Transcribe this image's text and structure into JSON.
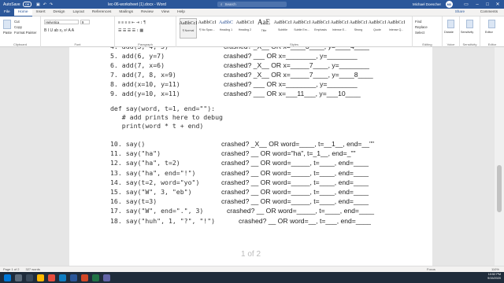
{
  "titlebar": {
    "autosave": "AutoSave",
    "autosave_state": "Off",
    "doc_title": "lec-06-worksheet (1).docx  -  Word",
    "search_placeholder": "Search",
    "user_name": "Michael Doescher",
    "user_initials": "MD"
  },
  "tabs": [
    "File",
    "Home",
    "Insert",
    "Design",
    "Layout",
    "References",
    "Mailings",
    "Review",
    "View",
    "Help"
  ],
  "tabs_right": {
    "share": "Share",
    "comments": "Comments"
  },
  "ribbon": {
    "clipboard": {
      "label": "Clipboard",
      "paste": "Paste",
      "cut": "Cut",
      "copy": "Copy",
      "format_painter": "Format Painter"
    },
    "font": {
      "label": "Font",
      "font_name": "Helvetica",
      "font_size": "9",
      "format_buttons": "B  I  U  ab  x₂  x²  A  A"
    },
    "paragraph": {
      "label": "Paragraph",
      "row1": "≡ ≡ ≡ ≡  ⇤ ⇥  ↕  ¶",
      "row2": "☰ ☰ ☰ ☰  ↕  ▦"
    },
    "styles": {
      "label": "Styles",
      "items": [
        {
          "preview": "AaBbCcI",
          "name": "¶ Normal"
        },
        {
          "preview": "AaBbCcI",
          "name": "¶ No Spac..."
        },
        {
          "preview": "AaBbC",
          "name": "Heading 1"
        },
        {
          "preview": "AaBbCcI",
          "name": "Heading 2"
        },
        {
          "preview": "AaE",
          "name": "Title"
        },
        {
          "preview": "AaBbCcI",
          "name": "Subtitle"
        },
        {
          "preview": "AaBbCcI",
          "name": "Subtle Em..."
        },
        {
          "preview": "AaBbCcI",
          "name": "Emphasis"
        },
        {
          "preview": "AaBbCcI",
          "name": "Intense E..."
        },
        {
          "preview": "AaBbCcI",
          "name": "Strong"
        },
        {
          "preview": "AaBbCcI",
          "name": "Quote"
        },
        {
          "preview": "AaBbCcI",
          "name": "Intense Q..."
        }
      ]
    },
    "editing": {
      "label": "Editing",
      "find": "Find",
      "replace": "Replace",
      "select": "Select"
    },
    "voice": {
      "label": "Voice",
      "dictate": "Dictate"
    },
    "sensitivity": {
      "label": "Sensitivity",
      "name": "Sensitivity"
    },
    "editor": {
      "label": "Editor",
      "name": "Editor"
    }
  },
  "document": {
    "code_lines": [
      "4. add(3, 4, 5)",
      "5. add(6, y=7)",
      "6. add(7, x=6)",
      "7. add(7, 8, x=9)",
      "8. add(x=10, y=11)",
      "9. add(y=10, x=11)"
    ],
    "answers_add": [
      "crashed? _X__ OR x=____3____, y=____4____",
      "crashed? ___ OR x=________, y=________",
      "crashed? _X__ OR x=_____7____, y=________",
      "crashed? _X__ OR x=_____7____, y=____8____",
      "crashed? ___ OR x=________, y=________",
      "crashed? ___ OR x=___11___, y=___10____"
    ],
    "def_lines": [
      "def say(word, t=1, end=\"\"):",
      "   # add prints here to debug",
      "   print(word * t + end)"
    ],
    "say_calls": [
      "10. say()",
      "11. say(\"ha\")",
      "12. say(\"ha\", t=2)",
      "13. say(\"ha\", end=\"!\")",
      "14. say(t=2, word=\"yo\")",
      "15. say(\"W\", 3, \"eb\")",
      "16. say(t=3)",
      "17. say(\"W\", end=\".\", 3)",
      "18. say(\"huh\", 1, \"?\", \"!\")"
    ],
    "say_answers": [
      "crashed? _X__ OR word=____, t=__1__, end=__\"\"",
      "crashed? __ OR word=\"ha\", t=_1__, end=_\"\"",
      "crashed? __ OR word=_____, t=____, end=____",
      "crashed? __ OR word=_____, t=____, end=____",
      "crashed? __ OR word=_____, t=____, end=____",
      "crashed? __ OR word=_____, t=____, end=____",
      "crashed? __ OR word=_____, t=____, end=____",
      "crashed? __ OR word=_____, t=____, end=____",
      "crashed? __ OR word=__, t=___, end=____"
    ],
    "page_number": "1 of 2"
  },
  "statusbar": {
    "page": "Page 1 of 2",
    "words": "327 words",
    "focus": "Focus",
    "zoom": "110%"
  },
  "taskbar": {
    "time": "10:52 PM",
    "date": "9/15/2020"
  },
  "colors": {
    "word_blue": "#2b579a",
    "taskbar": "#1f2c3b"
  }
}
